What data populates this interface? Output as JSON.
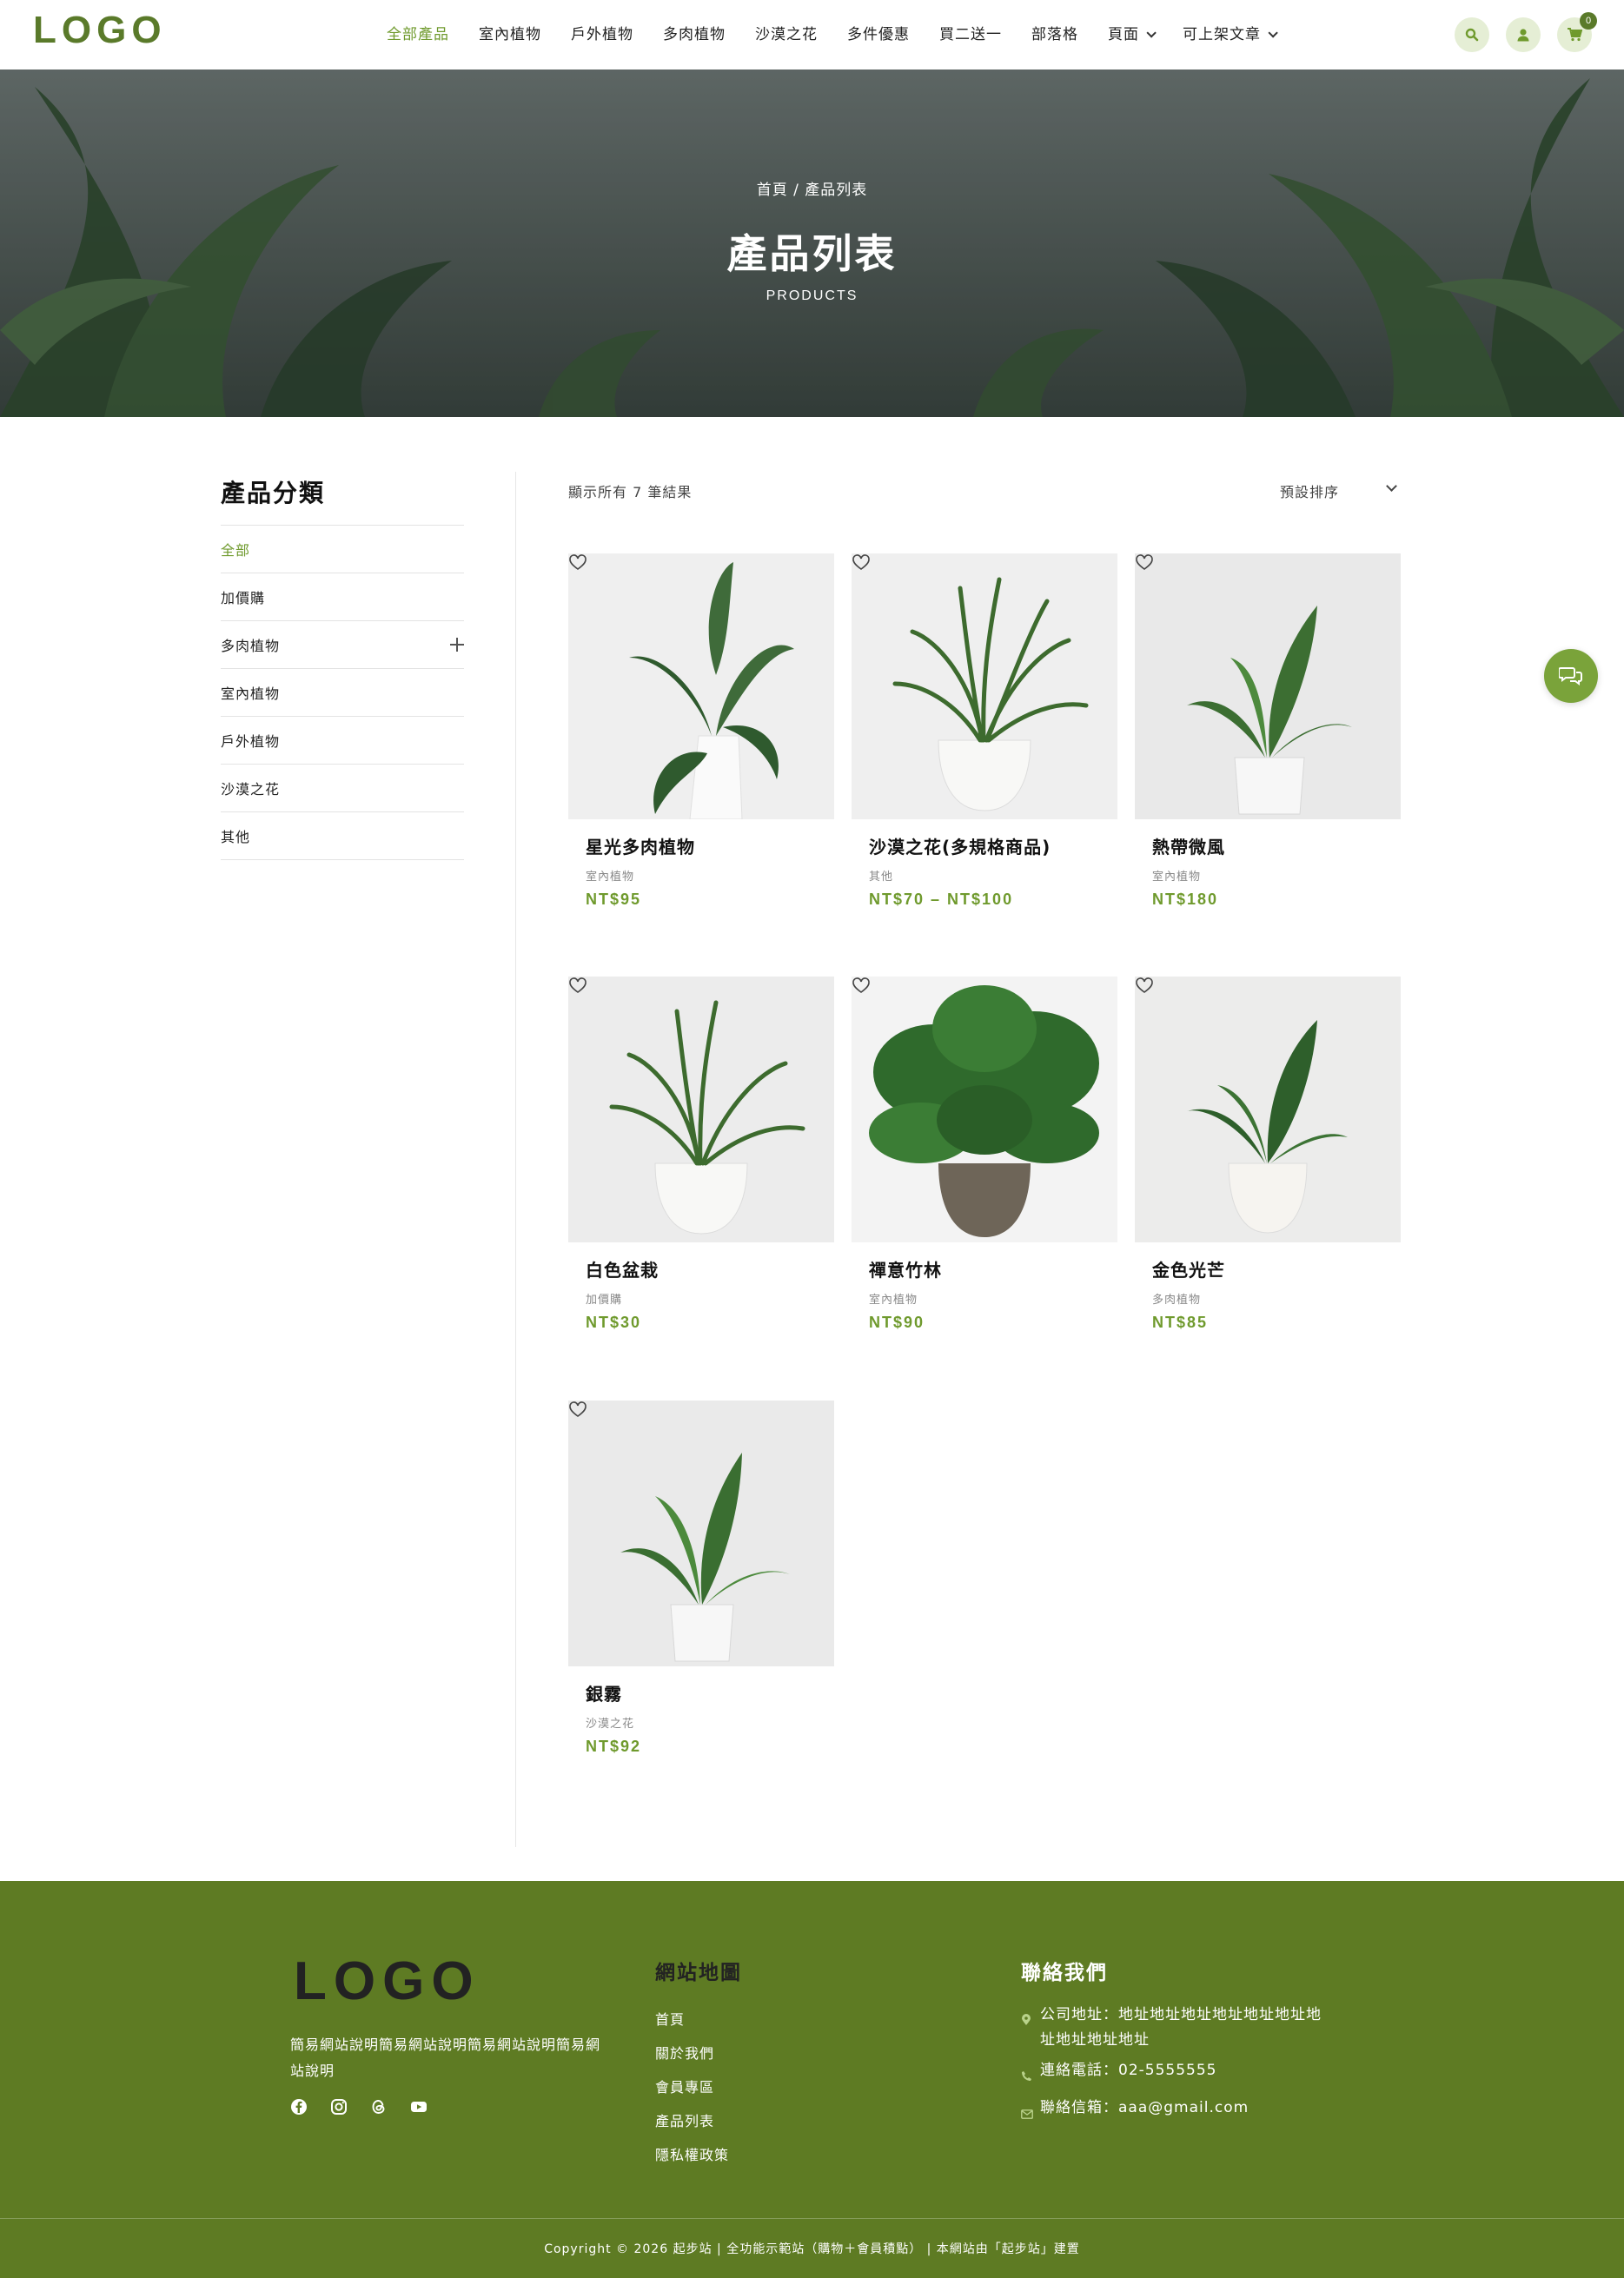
{
  "brand": {
    "logo": "LOGO",
    "accent": "#6f9a2d",
    "footer_bg": "#5e7b23"
  },
  "nav": [
    {
      "label": "全部產品",
      "active": true
    },
    {
      "label": "室內植物"
    },
    {
      "label": "戶外植物"
    },
    {
      "label": "多肉植物"
    },
    {
      "label": "沙漠之花"
    },
    {
      "label": "多件優惠"
    },
    {
      "label": "買二送一"
    },
    {
      "label": "部落格"
    },
    {
      "label": "頁面",
      "dropdown": true
    },
    {
      "label": "可上架文章",
      "dropdown": true
    }
  ],
  "header_icons": {
    "search": "search-icon",
    "account": "user-icon",
    "cart": "cart-icon",
    "cart_count": "0"
  },
  "hero": {
    "breadcrumb": "首頁 / 產品列表",
    "title": "產品列表",
    "subtitle": "PRODUCTS"
  },
  "sidebar": {
    "title": "產品分類",
    "items": [
      {
        "label": "全部",
        "active": true
      },
      {
        "label": "加價購"
      },
      {
        "label": "多肉植物",
        "expandable": true
      },
      {
        "label": "室內植物"
      },
      {
        "label": "戶外植物"
      },
      {
        "label": "沙漠之花"
      },
      {
        "label": "其他"
      }
    ]
  },
  "results": {
    "count_text": "顯示所有 7 筆結果",
    "sort_label": "預設排序"
  },
  "products": [
    {
      "name": "星光多肉植物",
      "category": "室內植物",
      "price": "NT$95"
    },
    {
      "name": "沙漠之花(多規格商品)",
      "category": "其他",
      "price": "NT$70 – NT$100"
    },
    {
      "name": "熱帶微風",
      "category": "室內植物",
      "price": "NT$180"
    },
    {
      "name": "白色盆栽",
      "category": "加價購",
      "price": "NT$30"
    },
    {
      "name": "禪意竹林",
      "category": "室內植物",
      "price": "NT$90"
    },
    {
      "name": "金色光芒",
      "category": "多肉植物",
      "price": "NT$85"
    },
    {
      "name": "銀霧",
      "category": "沙漠之花",
      "price": "NT$92"
    }
  ],
  "footer": {
    "logo": "LOGO",
    "description": "簡易網站說明簡易網站說明簡易網站說明簡易網站說明",
    "social": [
      "facebook-icon",
      "instagram-icon",
      "threads-icon",
      "youtube-icon"
    ],
    "sitemap_title": "網站地圖",
    "sitemap": [
      "首頁",
      "關於我們",
      "會員專區",
      "產品列表",
      "隱私權政策"
    ],
    "contact_title": "聯絡我們",
    "address": "公司地址：地址地址地址地址地址地址地址地址地址地址",
    "phone": "連絡電話：02-5555555",
    "email": "聯絡信箱：aaa@gmail.com",
    "copyright": "Copyright © 2026 起步站 | 全功能示範站（購物＋會員積點） | 本網站由「起步站」建置"
  }
}
